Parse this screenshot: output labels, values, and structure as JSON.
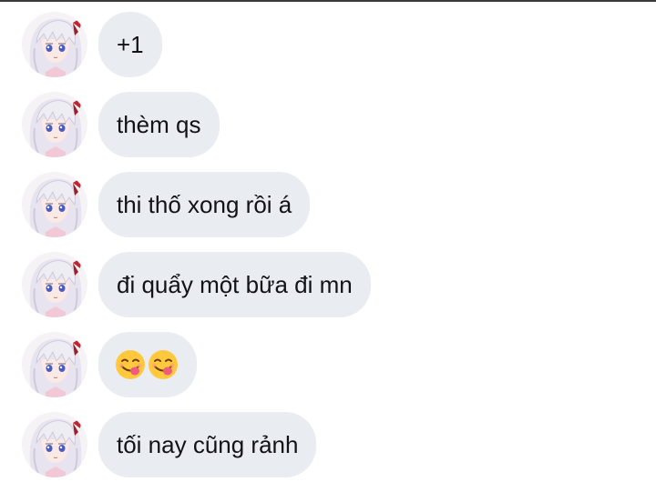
{
  "messages": [
    {
      "type": "text",
      "text": "+1"
    },
    {
      "type": "text",
      "text": "thèm qs"
    },
    {
      "type": "text",
      "text": "thi thố xong rồi á"
    },
    {
      "type": "text",
      "text": "đi quẩy một bữa đi mn"
    },
    {
      "type": "emoji",
      "icons": [
        "face-savoring-food-emoji",
        "face-savoring-food-emoji"
      ]
    },
    {
      "type": "text",
      "text": "tối nay cũng rảnh"
    }
  ],
  "colors": {
    "bubble_bg": "#e9ecf0",
    "text": "#111318",
    "emoji_face": "#ffc83d",
    "emoji_tongue": "#ef5b7a"
  }
}
